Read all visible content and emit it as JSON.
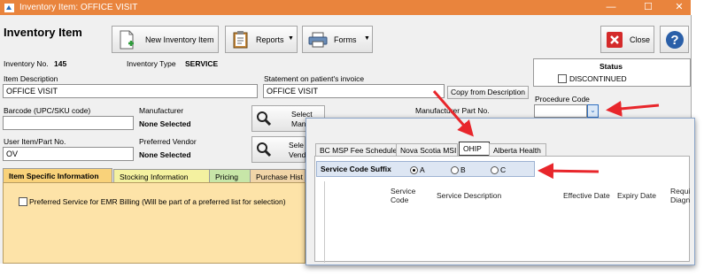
{
  "window": {
    "title": "Inventory Item:  OFFICE VISIT",
    "controls": {
      "minimize": "—",
      "maximize": "☐",
      "close": "✕"
    }
  },
  "header": {
    "title": "Inventory Item"
  },
  "toolbar": {
    "new_item": "New Inventory Item",
    "reports": "Reports",
    "forms": "Forms",
    "close": "Close"
  },
  "info": {
    "inventory_no_label": "Inventory No.",
    "inventory_no": "145",
    "inventory_type_label": "Inventory Type",
    "inventory_type": "SERVICE"
  },
  "fields": {
    "item_description_label": "Item Description",
    "item_description": "OFFICE VISIT",
    "statement_label": "Statement on patient's invoice",
    "statement": "OFFICE VISIT",
    "copy_from_description": "Copy from Description",
    "barcode_label": "Barcode (UPC/SKU code)",
    "barcode": "",
    "manufacturer_label": "Manufacturer",
    "manufacturer": "None Selected",
    "select_manufacturer": "Select Manufa",
    "manufacturer_part_label": "Manufacturer Part No.",
    "user_item_label": "User Item/Part No.",
    "user_item": "OV",
    "preferred_vendor_label": "Preferred Vendor",
    "preferred_vendor": "None Selected",
    "select_vendor": "Sele Vend"
  },
  "status": {
    "title": "Status",
    "discontinued": "DISCONTINUED"
  },
  "procedure_code": {
    "label": "Procedure Code",
    "value": ""
  },
  "tabs": [
    {
      "label": "Item Specific Information",
      "color": "#f9d27a"
    },
    {
      "label": "Stocking Information",
      "color": "#f4f1a0"
    },
    {
      "label": "Pricing",
      "color": "#c7e6a8"
    },
    {
      "label": "Purchase Hist",
      "color": "#f1d5a8"
    }
  ],
  "item_specific": {
    "preferred_service": "Preferred Service for EMR Billing (Will be part of a preferred list for selection)"
  },
  "popup": {
    "tabs": [
      {
        "label": "BC MSP Fee Schedule"
      },
      {
        "label": "Nova Scotia MSI"
      },
      {
        "label": "OHIP"
      },
      {
        "label": "Alberta Health"
      }
    ],
    "suffix_label": "Service Code Suffix",
    "suffix_options": [
      "A",
      "B",
      "C"
    ],
    "selected_suffix": "A",
    "columns": [
      "Service Code",
      "Service Description",
      "Effective Date",
      "Expiry Date",
      "Requi Diagno"
    ]
  },
  "colors": {
    "title_bar": "#e9843d",
    "arrow": "#e8262b",
    "tab_panel": "#fde3a8"
  }
}
